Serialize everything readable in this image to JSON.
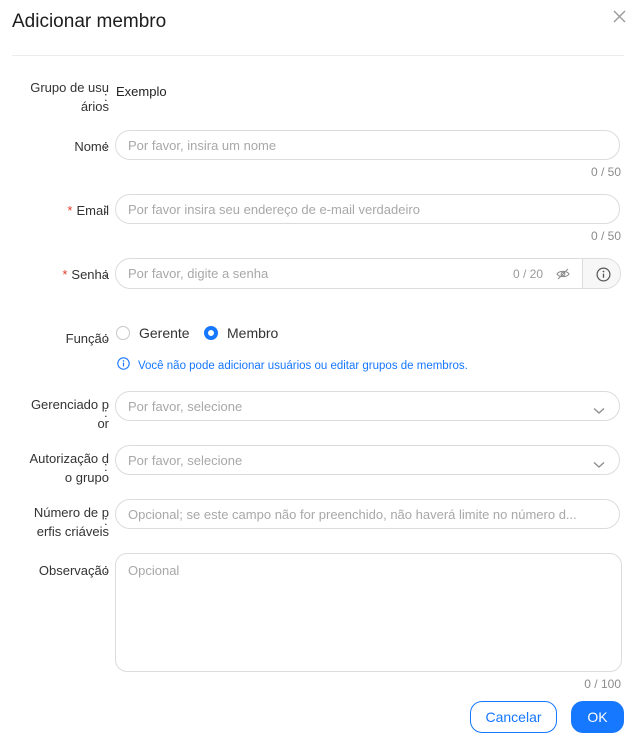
{
  "dialog": {
    "title": "Adicionar membro"
  },
  "form": {
    "user_group": {
      "label_line1": "Grupo de usu",
      "label_line2": "ários",
      "value": "Exemplo"
    },
    "name": {
      "label": "Nome",
      "placeholder": "Por favor, insira um nome",
      "counter": "0 / 50"
    },
    "email": {
      "required_mark": "*",
      "label": "Email",
      "placeholder": "Por favor insira seu endereço de e-mail verdadeiro",
      "counter": "0 / 50"
    },
    "password": {
      "required_mark": "*",
      "label": "Senha",
      "placeholder": "Por favor, digite a senha",
      "counter": "0 / 20"
    },
    "role": {
      "label": "Função",
      "options": [
        "Gerente",
        "Membro"
      ],
      "selected": "Membro",
      "hint": "Você não pode adicionar usuários ou editar grupos de membros."
    },
    "managed_by": {
      "label_line1": "Gerenciado p",
      "label_line2": "or",
      "placeholder": "Por favor, selecione"
    },
    "group_authorization": {
      "label_line1": "Autorização d",
      "label_line2": "o grupo",
      "placeholder": "Por favor, selecione"
    },
    "profile_count": {
      "label_line1": "Número de p",
      "label_line2": "erfis criáveis",
      "placeholder": "Opcional; se este campo não for preenchido, não haverá limite no número d..."
    },
    "remark": {
      "label": "Observação",
      "placeholder": "Opcional",
      "counter": "0 / 100"
    }
  },
  "footer": {
    "cancel_label": "Cancelar",
    "ok_label": "OK"
  },
  "colors": {
    "primary": "#1677ff",
    "required": "#e0402f",
    "placeholder": "#a8a8a8"
  }
}
